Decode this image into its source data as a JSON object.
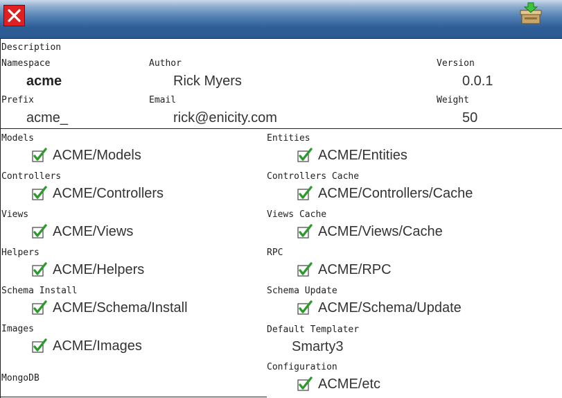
{
  "header": {
    "close_icon": "close-icon",
    "install_icon": "install-box-icon"
  },
  "info": {
    "description_label": "Description",
    "namespace_label": "Namespace",
    "namespace_value": "acme",
    "author_label": "Author",
    "author_value": "Rick Myers",
    "version_label": "Version",
    "version_value": "0.0.1",
    "prefix_label": "Prefix",
    "prefix_value": "acme_",
    "email_label": "Email",
    "email_value": "rick@enicity.com",
    "weight_label": "Weight",
    "weight_value": "50"
  },
  "left": [
    {
      "label": "Models",
      "value": "ACME/Models",
      "checked": true
    },
    {
      "label": "Controllers",
      "value": "ACME/Controllers",
      "checked": true
    },
    {
      "label": "Views",
      "value": "ACME/Views",
      "checked": true
    },
    {
      "label": "Helpers",
      "value": "ACME/Helpers",
      "checked": true
    },
    {
      "label": "Schema Install",
      "value": "ACME/Schema/Install",
      "checked": true
    },
    {
      "label": "Images",
      "value": "ACME/Images",
      "checked": true
    },
    {
      "label": "MongoDB",
      "value": "",
      "checked": false
    }
  ],
  "right": [
    {
      "label": "Entities",
      "value": "ACME/Entities",
      "checked": true
    },
    {
      "label": "Controllers Cache",
      "value": "ACME/Controllers/Cache",
      "checked": true
    },
    {
      "label": "Views Cache",
      "value": "ACME/Views/Cache",
      "checked": true
    },
    {
      "label": "RPC",
      "value": "ACME/RPC",
      "checked": true
    },
    {
      "label": "Schema Update",
      "value": "ACME/Schema/Update",
      "checked": true
    },
    {
      "label": "Default Templater",
      "value": "Smarty3",
      "checked": false
    },
    {
      "label": "Configuration",
      "value": "ACME/etc",
      "checked": true
    }
  ],
  "colors": {
    "title_blue": "#2f5f98",
    "close_red": "#e02020",
    "check_green": "#2e9a2e"
  }
}
